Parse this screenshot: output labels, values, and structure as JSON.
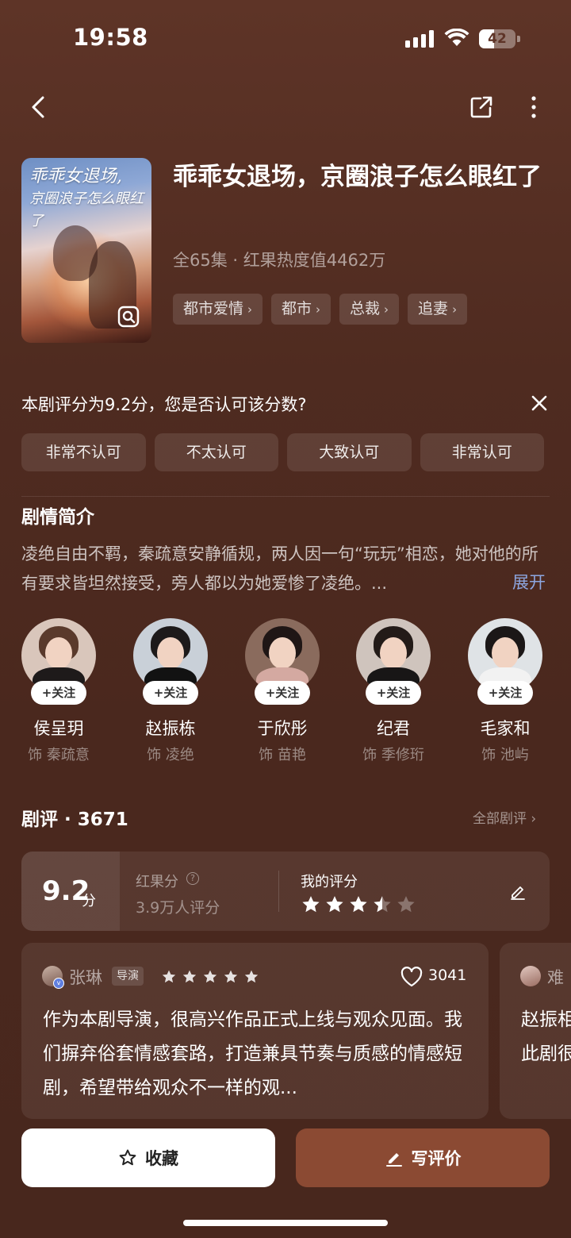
{
  "status_bar": {
    "time": "19:58",
    "battery": "42",
    "battery_level": 0.42
  },
  "header": {
    "back_icon": "chevron-left-icon",
    "share_icon": "share-icon",
    "more_icon": "more-vertical-icon"
  },
  "drama": {
    "poster_title": "乖乖女退场，京圈浪子怎么眼红了",
    "title": "乖乖女退场，京圈浪子怎么眼红了",
    "meta": "全65集 · 红果热度值4462万",
    "tags": [
      {
        "label": "都市爱情"
      },
      {
        "label": "都市"
      },
      {
        "label": "总裁"
      },
      {
        "label": "追妻"
      }
    ]
  },
  "rating_prompt": {
    "question": "本剧评分为9.2分，您是否认可该分数?",
    "options": [
      "非常不认可",
      "不太认可",
      "大致认可",
      "非常认可"
    ]
  },
  "synopsis": {
    "title": "剧情简介",
    "text": "凌绝自由不羁，秦疏意安静循规，两人因一句“玩玩”相恋，她对他的所有要求皆坦然接受，旁人都以为她爱惨了凌绝。...",
    "expand": "展开"
  },
  "cast": [
    {
      "name": "侯呈玥",
      "role": "饰 秦疏意",
      "follow": "+关注"
    },
    {
      "name": "赵振栋",
      "role": "饰 凌绝",
      "follow": "+关注"
    },
    {
      "name": "于欣彤",
      "role": "饰 苗艳",
      "follow": "+关注"
    },
    {
      "name": "纪君",
      "role": "饰 季修珩",
      "follow": "+关注"
    },
    {
      "name": "毛家和",
      "role": "饰 池屿",
      "follow": "+关注"
    }
  ],
  "reviews": {
    "title": "剧评 · 3671",
    "all_link": "全部剧评 ›",
    "score": "9.2",
    "score_unit": "分",
    "hongguo_label": "红果分",
    "raters": "3.9万人评分",
    "my_rating_label": "我的评分",
    "my_rating": 3.5,
    "cards": [
      {
        "user": "张琳",
        "role": "导演",
        "stars": 5,
        "likes": "3041",
        "text": "作为本剧导演，很高兴作品正式上线与观众见面。我们摒弃俗套情感套路，打造兼具节奏与质感的情感短剧，希望带给观众不一样的观..."
      },
      {
        "user": "难",
        "text_line1": "赵振相",
        "text_line2": "此剧很"
      }
    ]
  },
  "actions": {
    "favorite": "收藏",
    "write_review": "写评价"
  },
  "colors": {
    "background": "#5e3427",
    "accent_button": "#8b4a33",
    "link": "#8da6e0"
  }
}
